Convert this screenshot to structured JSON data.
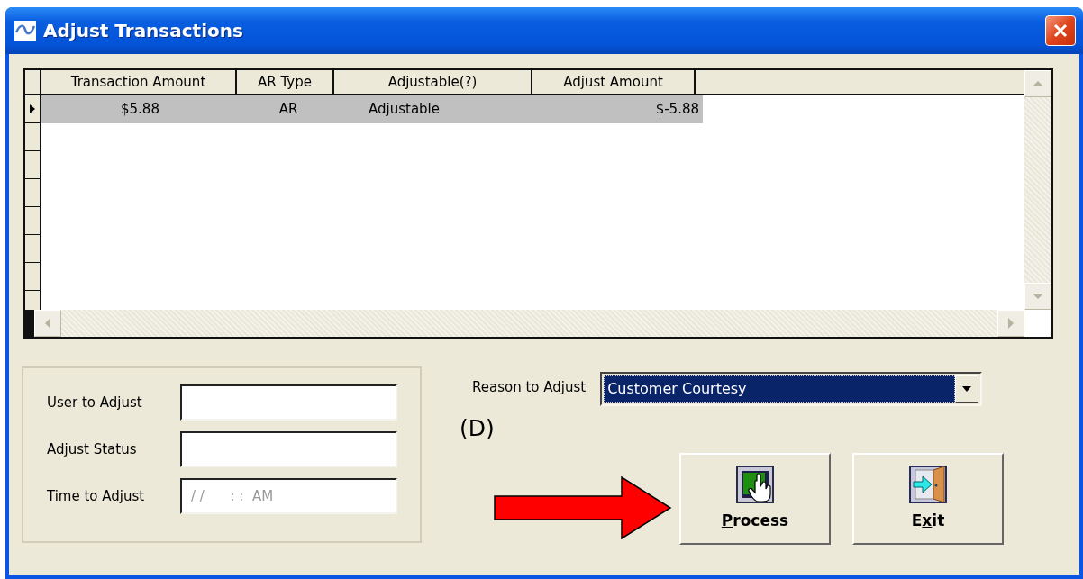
{
  "window": {
    "title": "Adjust Transactions"
  },
  "grid": {
    "columns": [
      {
        "label": "Transaction Amount"
      },
      {
        "label": "AR Type"
      },
      {
        "label": "Adjustable(?)"
      },
      {
        "label": "Adjust Amount"
      }
    ],
    "rows": [
      {
        "selected": true,
        "cells": [
          "$5.88",
          "AR",
          "Adjustable",
          "$-5.88"
        ]
      }
    ]
  },
  "fields": [
    {
      "label": "User to Adjust"
    },
    {
      "label": "Adjust Status"
    },
    {
      "label": "Time to Adjust",
      "placeholder": "/ /      : :  AM"
    }
  ],
  "reason": {
    "label": "Reason to Adjust",
    "value": "Customer Courtesy",
    "highlighted": true
  },
  "annotation": {
    "label": "(D)"
  },
  "buttons": [
    {
      "kind": "process",
      "parts": [
        {
          "text": "P",
          "underlined": true
        },
        {
          "text": "rocess",
          "underlined": false
        }
      ]
    },
    {
      "kind": "exit",
      "parts": [
        {
          "text": "E",
          "underlined": false
        },
        {
          "text": "x",
          "underlined": true
        },
        {
          "text": "it",
          "underlined": false
        }
      ]
    }
  ]
}
